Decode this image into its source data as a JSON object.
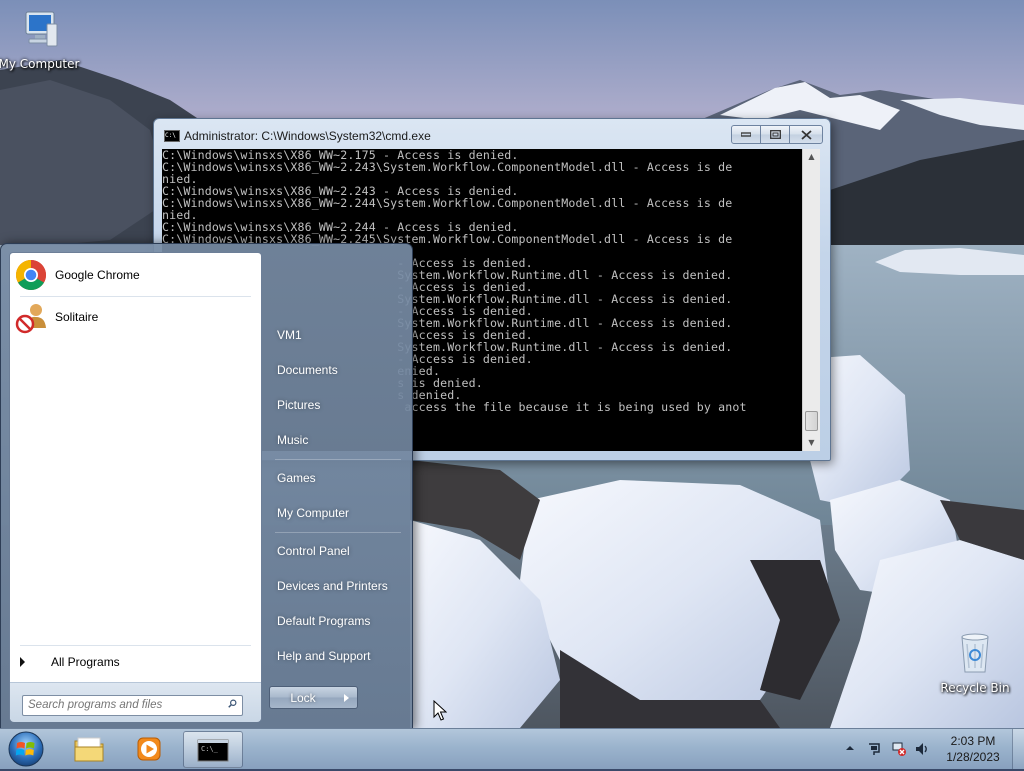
{
  "desktop": {
    "icons": [
      {
        "label": "My Computer",
        "icon": "computer-icon"
      },
      {
        "label": "Recycle Bin",
        "icon": "recycle-bin-icon"
      }
    ]
  },
  "cmd": {
    "title": "Administrator: C:\\Windows\\System32\\cmd.exe",
    "buttons": {
      "minimize": "▭",
      "maximize": "▢",
      "close": "✕"
    },
    "lines": [
      "C:\\Windows\\winsxs\\X86_WW~2.175 - Access is denied.",
      "C:\\Windows\\winsxs\\X86_WW~2.243\\System.Workflow.ComponentModel.dll - Access is de",
      "nied.",
      "C:\\Windows\\winsxs\\X86_WW~2.243 - Access is denied.",
      "C:\\Windows\\winsxs\\X86_WW~2.244\\System.Workflow.ComponentModel.dll - Access is de",
      "nied.",
      "C:\\Windows\\winsxs\\X86_WW~2.244 - Access is denied.",
      "C:\\Windows\\winsxs\\X86_WW~2.245\\System.Workflow.ComponentModel.dll - Access is de",
      "                                      ",
      "                                 - Access is denied.",
      "                                 System.Workflow.Runtime.dll - Access is denied.",
      "                                 - Access is denied.",
      "                                 System.Workflow.Runtime.dll - Access is denied.",
      "                                 - Access is denied.",
      "                                 System.Workflow.Runtime.dll - Access is denied.",
      "                                 - Access is denied.",
      "                                 System.Workflow.Runtime.dll - Access is denied.",
      "                                 - Access is denied.",
      "                                 enied.",
      "                                 s is denied.",
      "                                 s denied.",
      "                                  access the file because it is being used by anot"
    ]
  },
  "start_menu": {
    "programs": [
      {
        "label": "Google Chrome",
        "icon": "chrome-icon"
      },
      {
        "label": "Solitaire",
        "icon": "solitaire-icon"
      }
    ],
    "all_programs": "All Programs",
    "search_placeholder": "Search programs and files",
    "right_items": [
      "VM1",
      "Documents",
      "Pictures",
      "Music",
      "Games",
      "My Computer",
      "Control Panel",
      "Devices and Printers",
      "Default Programs",
      "Help and Support"
    ],
    "lock_label": "Lock"
  },
  "taskbar": {
    "clock_time": "2:03 PM",
    "clock_date": "1/28/2023",
    "pinned": [
      "explorer-icon",
      "media-player-icon",
      "cmd-icon"
    ]
  },
  "colors": {
    "console_bg": "#000000",
    "console_fg": "#c0c0c0",
    "start_menu_glass": "#7a8ca6"
  }
}
